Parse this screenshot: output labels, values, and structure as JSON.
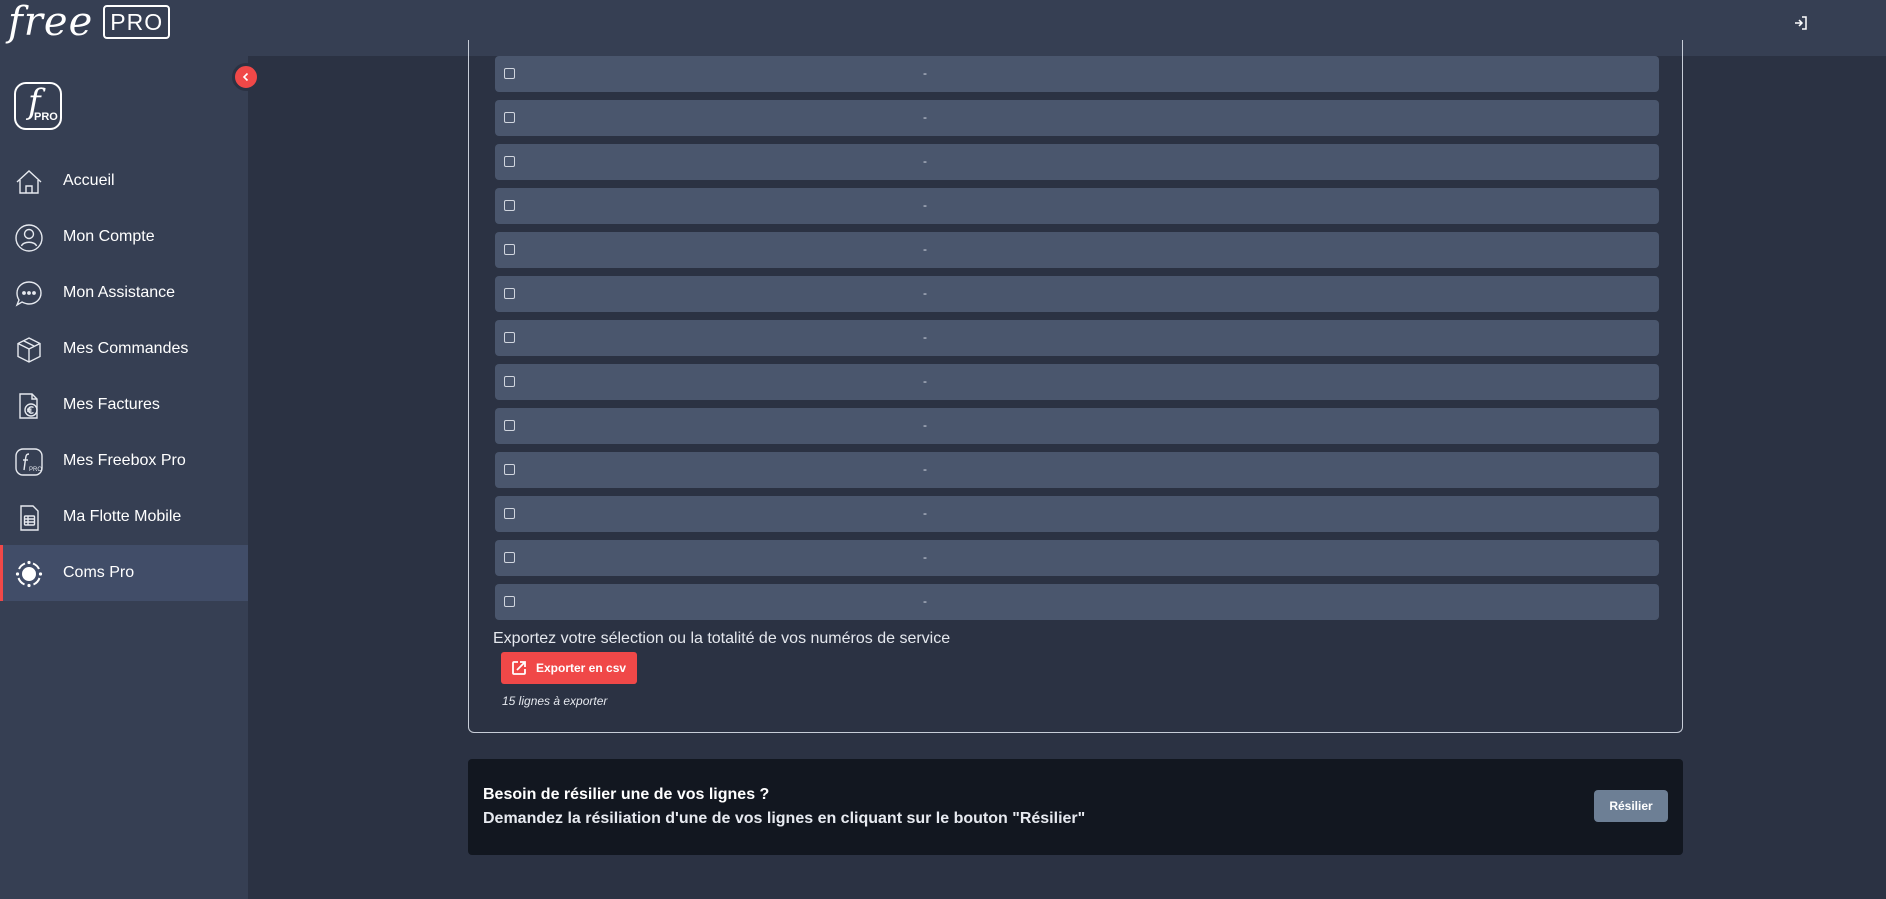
{
  "header": {
    "logo_free": "free",
    "logo_pro": "PRO",
    "logout_icon": "logout-icon"
  },
  "sidebar": {
    "logo_f": "f",
    "logo_pro": "PRO",
    "collapse_icon": "chevron-left-icon",
    "items": [
      {
        "label": "Accueil",
        "icon": "home-icon"
      },
      {
        "label": "Mon Compte",
        "icon": "user-icon"
      },
      {
        "label": "Mon Assistance",
        "icon": "chat-bubble-icon"
      },
      {
        "label": "Mes Commandes",
        "icon": "package-icon"
      },
      {
        "label": "Mes Factures",
        "icon": "invoice-euro-icon"
      },
      {
        "label": "Mes Freebox Pro",
        "icon": "freebox-icon"
      },
      {
        "label": "Ma Flotte Mobile",
        "icon": "sim-card-icon"
      },
      {
        "label": "Coms Pro",
        "icon": "coms-pro-icon",
        "active": true
      }
    ],
    "accent_color": "#f04848"
  },
  "list": {
    "rows": [
      {
        "value": "-"
      },
      {
        "value": "-"
      },
      {
        "value": "-"
      },
      {
        "value": "-"
      },
      {
        "value": "-"
      },
      {
        "value": "-"
      },
      {
        "value": "-"
      },
      {
        "value": "-"
      },
      {
        "value": "-"
      },
      {
        "value": "-"
      },
      {
        "value": "-"
      },
      {
        "value": "-"
      },
      {
        "value": "-"
      }
    ]
  },
  "export": {
    "text": "Exportez votre sélection ou la totalité de vos numéros de service",
    "button_label": "Exporter en csv",
    "button_icon": "export-icon",
    "count_text": "15 lignes à exporter"
  },
  "resiliation": {
    "title": "Besoin de résilier une de vos lignes ?",
    "description": "Demandez la résiliation d'une de vos lignes en cliquant sur le bouton \"Résilier\"",
    "button_label": "Résilier"
  }
}
